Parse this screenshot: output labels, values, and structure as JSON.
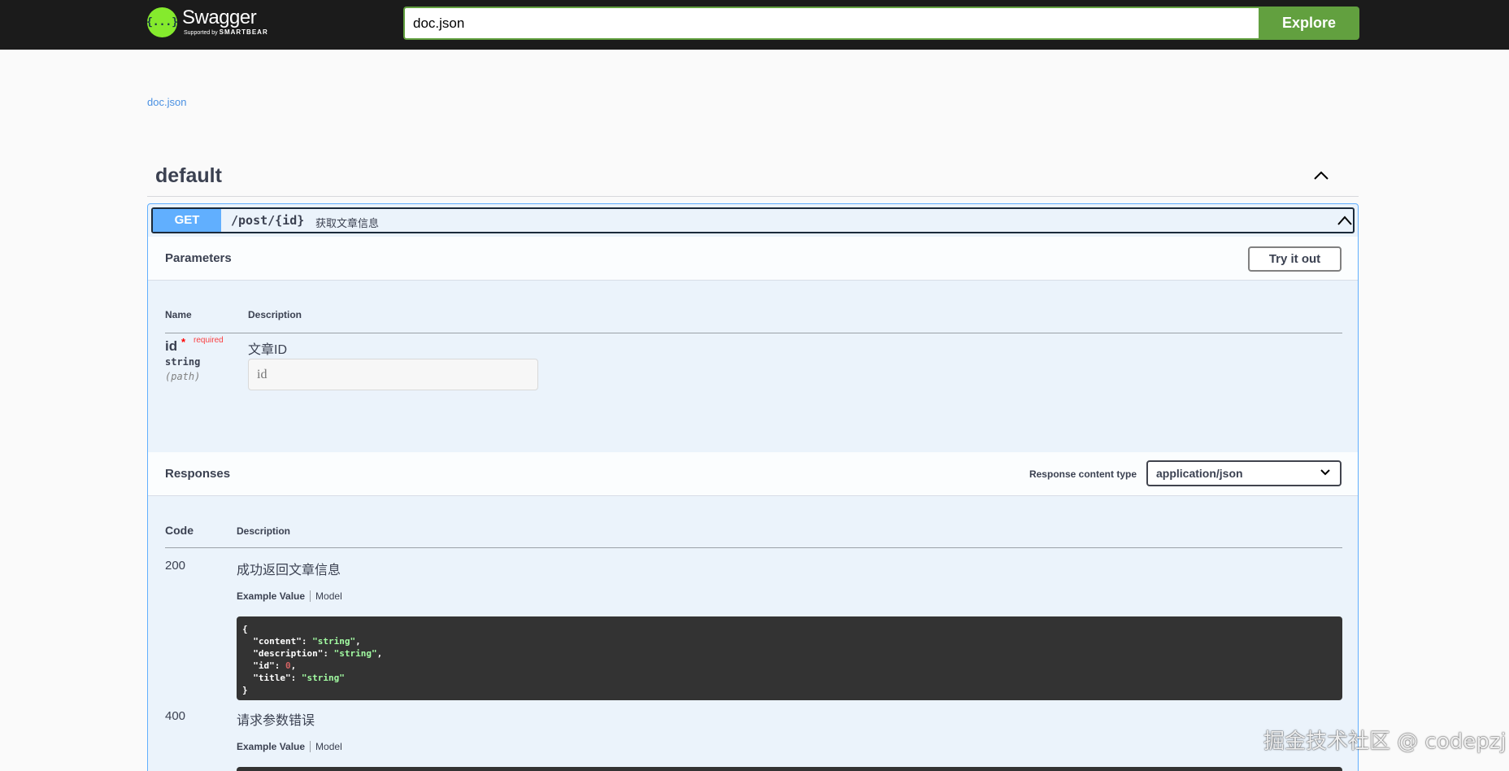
{
  "topbar": {
    "logo_name": "Swagger",
    "logo_supported": "Supported by",
    "logo_brand": "SMARTBEAR",
    "logo_mark": "{...}",
    "url_value": "doc.json",
    "explore_label": "Explore"
  },
  "spec_link": "doc.json",
  "tag": {
    "name": "default"
  },
  "operation": {
    "method": "GET",
    "path": "/post/{id}",
    "summary": "获取文章信息"
  },
  "parameters": {
    "title": "Parameters",
    "try_it_out": "Try it out",
    "col_name": "Name",
    "col_description": "Description",
    "items": [
      {
        "name": "id",
        "required_mark": "*",
        "required_text": "required",
        "type": "string",
        "in": "(path)",
        "description": "文章ID",
        "placeholder": "id"
      }
    ]
  },
  "responses": {
    "title": "Responses",
    "content_type_label": "Response content type",
    "content_type_value": "application/json",
    "col_code": "Code",
    "col_description": "Description",
    "items": [
      {
        "code": "200",
        "description": "成功返回文章信息",
        "tab_example": "Example Value",
        "tab_model": "Model",
        "example": {
          "open": "{",
          "close": "}",
          "lines": [
            {
              "key": "\"content\"",
              "value": "\"string\"",
              "kind": "string",
              "comma": ","
            },
            {
              "key": "\"description\"",
              "value": "\"string\"",
              "kind": "string",
              "comma": ","
            },
            {
              "key": "\"id\"",
              "value": "0",
              "kind": "number",
              "comma": ","
            },
            {
              "key": "\"title\"",
              "value": "\"string\"",
              "kind": "string",
              "comma": ""
            }
          ]
        }
      },
      {
        "code": "400",
        "description": "请求参数错误",
        "tab_example": "Example Value",
        "tab_model": "Model"
      }
    ]
  },
  "watermark": "掘金技术社区 @ codepzj",
  "colors": {
    "topbar_bg": "#1b1b1b",
    "accent_green": "#62a03f",
    "get_blue": "#61affe",
    "opblock_bg": "#ebf3fb",
    "link_blue": "#4990e2"
  }
}
